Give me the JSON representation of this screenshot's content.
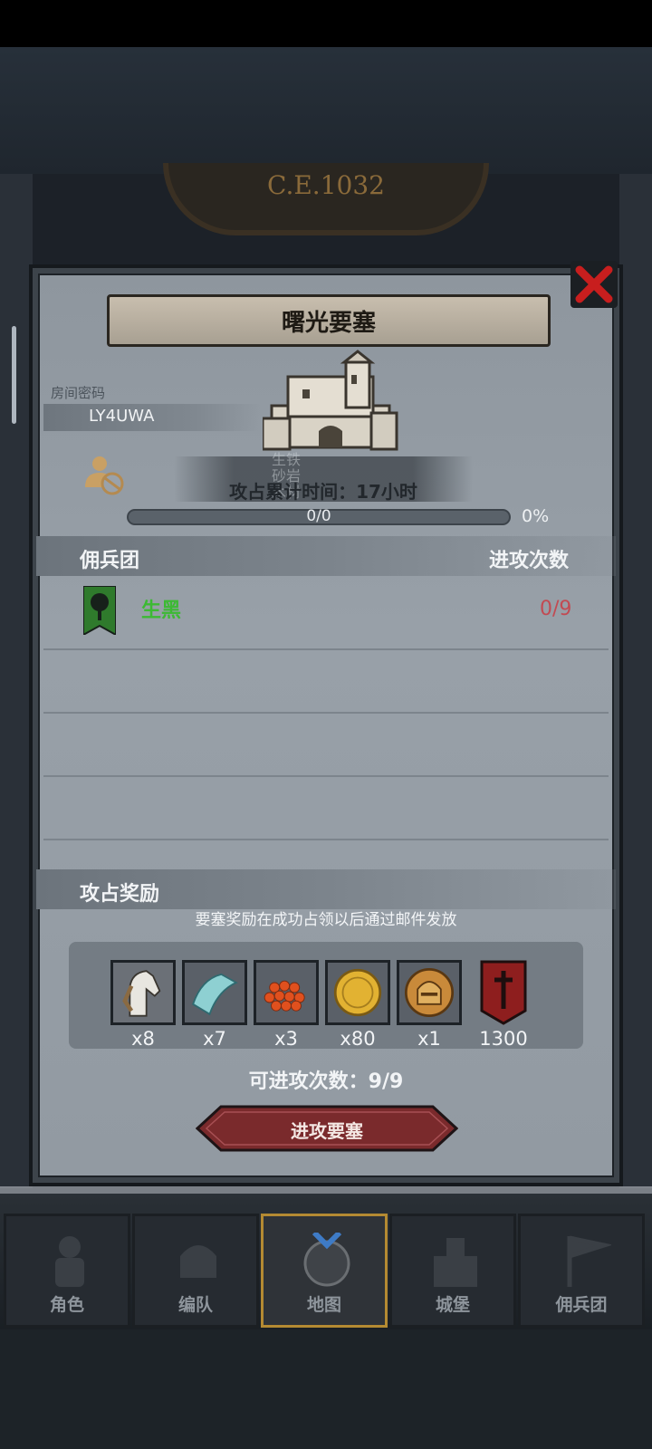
{
  "background": {
    "year_label": "C.E.1032"
  },
  "panel": {
    "title": "曙光要塞",
    "room_code_label": "房间密码",
    "room_code": "LY4UWA",
    "occupy_time": "攻占累计时间：17小时",
    "progress_text": "0/0",
    "progress_percent": "0%",
    "progress_value": 0,
    "resource_ghosts": [
      "生铁",
      "砂岩",
      "木材"
    ]
  },
  "mercenary_section": {
    "header_left": "佣兵团",
    "header_right": "进攻次数",
    "rows": [
      {
        "name": "生黑",
        "count": "0/9",
        "icon": "tree-banner-icon"
      }
    ]
  },
  "reward_section": {
    "title": "攻占奖励",
    "note": "要塞奖励在成功占领以后通过邮件发放",
    "items": [
      {
        "icon": "horse-icon",
        "qty": "x8"
      },
      {
        "icon": "cloth-icon",
        "qty": "x7"
      },
      {
        "icon": "beads-icon",
        "qty": "x3"
      },
      {
        "icon": "gold-coin-icon",
        "qty": "x80"
      },
      {
        "icon": "helmet-medal-icon",
        "qty": "x1"
      },
      {
        "icon": "sword-banner-icon",
        "qty": "1300"
      }
    ]
  },
  "attack": {
    "remaining": "可进攻次数：9/9",
    "button_label": "进攻要塞"
  },
  "bottom_nav": [
    {
      "label": "角色",
      "active": false
    },
    {
      "label": "编队",
      "active": false
    },
    {
      "label": "地图",
      "active": true
    },
    {
      "label": "城堡",
      "active": false
    },
    {
      "label": "佣兵团",
      "active": false
    }
  ],
  "colors": {
    "merc_name": "#3cba33",
    "merc_count": "#c24a52",
    "close_red": "#c81e1e",
    "attack_button": "#7a2a2c",
    "nav_active_border": "#b48a32"
  }
}
